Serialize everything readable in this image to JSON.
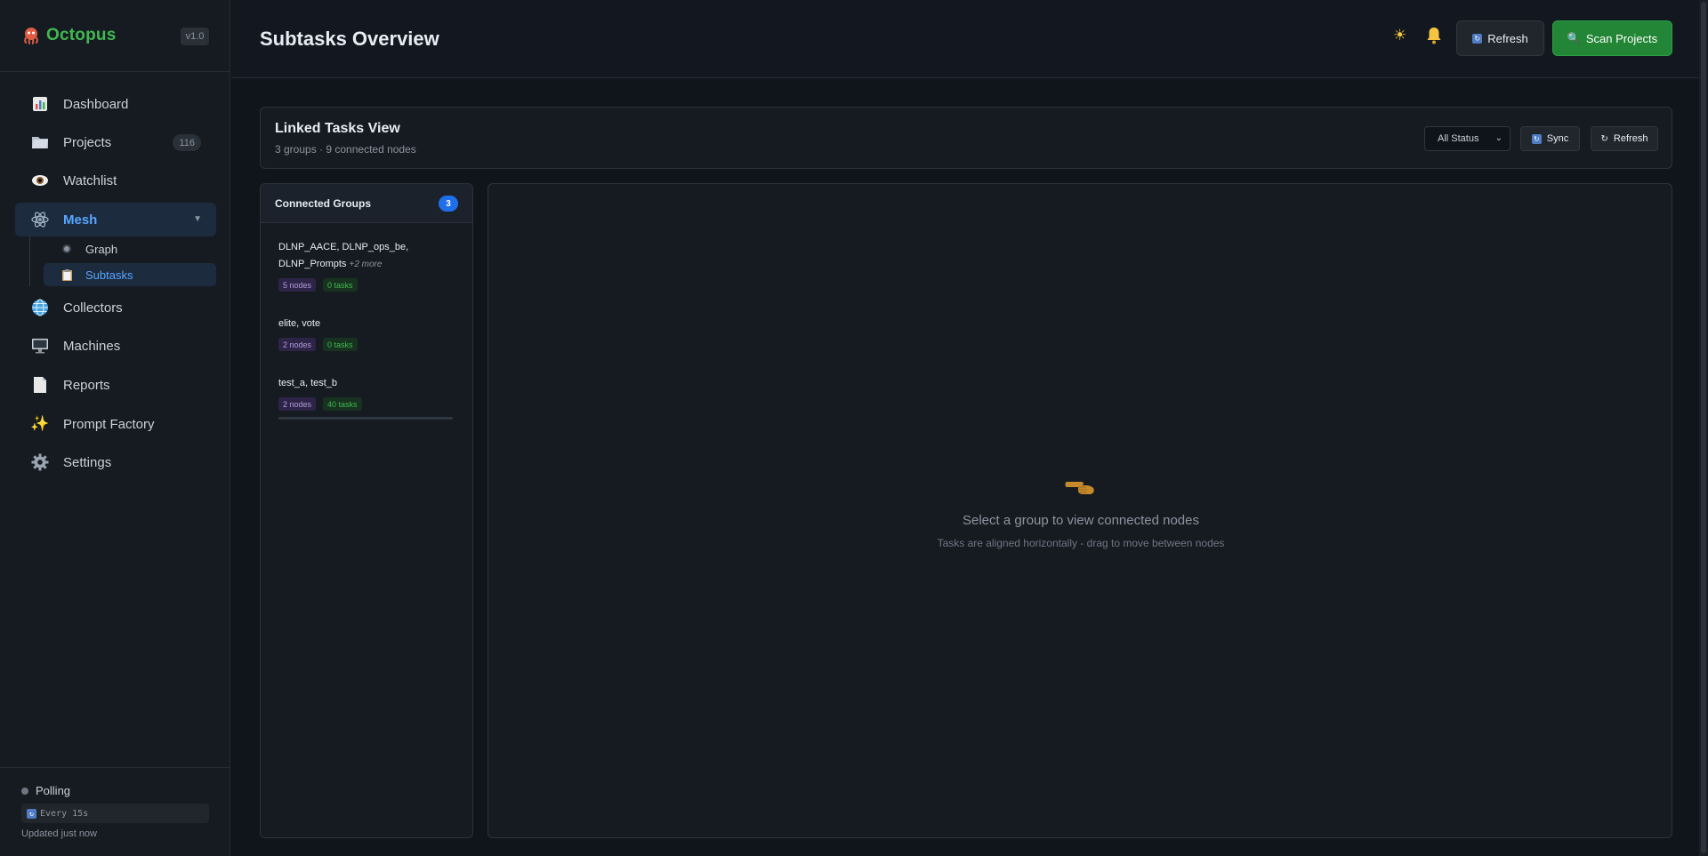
{
  "app": {
    "name": "Octopus",
    "version": "v1.0"
  },
  "sidebar": {
    "items": [
      {
        "label": "Dashboard",
        "icon": "bar-chart-icon"
      },
      {
        "label": "Projects",
        "icon": "folder-icon",
        "badge": "116"
      },
      {
        "label": "Watchlist",
        "icon": "eye-icon"
      },
      {
        "label": "Mesh",
        "icon": "atom-icon"
      },
      {
        "label": "Collectors",
        "icon": "globe-icon"
      },
      {
        "label": "Machines",
        "icon": "monitor-icon"
      },
      {
        "label": "Reports",
        "icon": "document-icon"
      },
      {
        "label": "Prompt Factory",
        "icon": "sparkles-icon"
      },
      {
        "label": "Settings",
        "icon": "gear-icon"
      }
    ],
    "mesh_sub": [
      {
        "label": "Graph",
        "icon": "radio-icon"
      },
      {
        "label": "Subtasks",
        "icon": "clipboard-icon"
      }
    ],
    "footer": {
      "polling_label": "Polling",
      "interval": "Every 15s",
      "updated": "Updated just now"
    }
  },
  "header": {
    "title": "Subtasks Overview",
    "refresh_label": "Refresh",
    "scan_label": "Scan Projects"
  },
  "linked_view": {
    "title": "Linked Tasks View",
    "subtitle": "3 groups · 9 connected nodes",
    "status_filter": "All Status",
    "sync_label": "Sync",
    "refresh_label": "Refresh"
  },
  "groups_panel": {
    "title": "Connected Groups",
    "count": "3",
    "groups": [
      {
        "line1": "DLNP_AACE, DLNP_ops_be,",
        "line2": "DLNP_Prompts",
        "more": "+2 more",
        "nodes": "5 nodes",
        "tasks": "0 tasks"
      },
      {
        "line1": "elite, vote",
        "nodes": "2 nodes",
        "tasks": "0 tasks"
      },
      {
        "line1": "test_a, test_b",
        "nodes": "2 nodes",
        "tasks": "40 tasks"
      }
    ]
  },
  "empty_state": {
    "icon": "pointing-hand-icon",
    "title": "Select a group to view connected nodes",
    "subtitle": "Tasks are aligned horizontally - drag to move between nodes"
  },
  "colors": {
    "accent": "#58a6ff",
    "green": "#238636",
    "badge_blue": "#1f6feb"
  }
}
